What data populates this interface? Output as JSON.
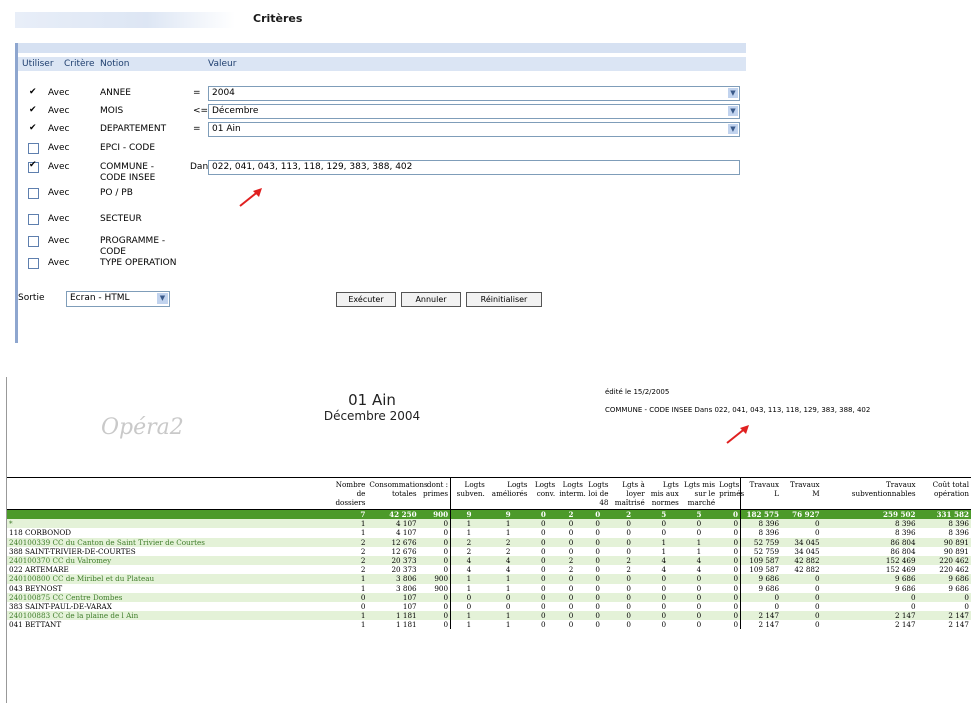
{
  "page_title": "Critères",
  "criteria": {
    "headers": {
      "utiliser": "Utiliser",
      "critere": "Critère",
      "notion": "Notion",
      "valeur": "Valeur"
    },
    "rows": [
      {
        "checked": true,
        "plain": true,
        "avec": "Avec",
        "notion": "ANNEE",
        "op": "=",
        "value": "2004",
        "dropdown": true
      },
      {
        "checked": true,
        "plain": true,
        "avec": "Avec",
        "notion": "MOIS",
        "op": "<=",
        "value": "Décembre",
        "dropdown": true
      },
      {
        "checked": true,
        "plain": true,
        "avec": "Avec",
        "notion": "DEPARTEMENT",
        "op": "=",
        "value": "01 Ain",
        "dropdown": true
      },
      {
        "checked": false,
        "avec": "Avec",
        "notion": "EPCI - CODE",
        "op": "",
        "value": null
      },
      {
        "checked": true,
        "avec": "Avec",
        "notion": "COMMUNE - CODE INSEE",
        "op": "Dans",
        "value": "022, 041, 043, 113, 118, 129, 383, 388, 402",
        "dropdown": false
      },
      {
        "checked": false,
        "avec": "Avec",
        "notion": "PO / PB",
        "op": "",
        "value": null
      },
      {
        "checked": false,
        "avec": "Avec",
        "notion": "SECTEUR",
        "op": "",
        "value": null
      },
      {
        "checked": false,
        "avec": "Avec",
        "notion": "PROGRAMME - CODE",
        "op": "",
        "value": null
      },
      {
        "checked": false,
        "avec": "Avec",
        "notion": "TYPE OPERATION",
        "op": "",
        "value": null
      }
    ],
    "sortie_label": "Sortie",
    "sortie_value": "Ecran - HTML",
    "buttons": {
      "executer": "Exécuter",
      "annuler": "Annuler",
      "reinitialiser": "Réinitialiser"
    }
  },
  "report": {
    "logo_text": "Opéra2",
    "title": "01 Ain",
    "subtitle": "Décembre 2004",
    "edite": "édité le 15/2/2005",
    "filter": "COMMUNE - CODE INSEE Dans 022, 041, 043, 113, 118, 129, 383, 388, 402",
    "columns": [
      "Nombre de dossiers",
      "Consommations totales",
      "dont : primes",
      "Logts subven.",
      "Logts améliorés",
      "Logts conv.",
      "Logts interm.",
      "Logts loi de 48",
      "Lgts à loyer maîtrisé",
      "Lgts mis aux normes",
      "Lgts mis sur le marché",
      "Logts primés",
      "Travaux L",
      "Travaux M",
      "Travaux subventionnables",
      "Coût total opération"
    ],
    "total": [
      "7",
      "42 250",
      "900",
      "9",
      "9",
      "0",
      "2",
      "0",
      "2",
      "5",
      "5",
      "0",
      "182 575",
      "76 927",
      "259 502",
      "331 582"
    ],
    "rows": [
      {
        "type": "lg",
        "label": "*",
        "values": [
          "1",
          "4 107",
          "0",
          "1",
          "1",
          "0",
          "0",
          "0",
          "0",
          "0",
          "0",
          "0",
          "8 396",
          "0",
          "8 396",
          "8 396"
        ]
      },
      {
        "type": "c",
        "label": "118 CORBONOD",
        "values": [
          "1",
          "4 107",
          "0",
          "1",
          "1",
          "0",
          "0",
          "0",
          "0",
          "0",
          "0",
          "0",
          "8 396",
          "0",
          "8 396",
          "8 396"
        ]
      },
      {
        "type": "lg",
        "label": "240100339 CC du Canton de Saint Trivier de Courtes",
        "values": [
          "2",
          "12 676",
          "0",
          "2",
          "2",
          "0",
          "0",
          "0",
          "0",
          "1",
          "1",
          "0",
          "52 759",
          "34 045",
          "86 804",
          "90 891"
        ]
      },
      {
        "type": "c",
        "label": "388 SAINT-TRIVIER-DE-COURTES",
        "values": [
          "2",
          "12 676",
          "0",
          "2",
          "2",
          "0",
          "0",
          "0",
          "0",
          "1",
          "1",
          "0",
          "52 759",
          "34 045",
          "86 804",
          "90 891"
        ]
      },
      {
        "type": "lg",
        "label": "240100370 CC du Valromey",
        "values": [
          "2",
          "20 373",
          "0",
          "4",
          "4",
          "0",
          "2",
          "0",
          "2",
          "4",
          "4",
          "0",
          "109 587",
          "42 882",
          "152 469",
          "220 462"
        ]
      },
      {
        "type": "c",
        "label": "022 ARTEMARE",
        "values": [
          "2",
          "20 373",
          "0",
          "4",
          "4",
          "0",
          "2",
          "0",
          "2",
          "4",
          "4",
          "0",
          "109 587",
          "42 882",
          "152 469",
          "220 462"
        ]
      },
      {
        "type": "lg",
        "label": "240100800 CC de Miribel et du Plateau",
        "values": [
          "1",
          "3 806",
          "900",
          "1",
          "1",
          "0",
          "0",
          "0",
          "0",
          "0",
          "0",
          "0",
          "9 686",
          "0",
          "9 686",
          "9 686"
        ]
      },
      {
        "type": "c",
        "label": "043 BEYNOST",
        "values": [
          "1",
          "3 806",
          "900",
          "1",
          "1",
          "0",
          "0",
          "0",
          "0",
          "0",
          "0",
          "0",
          "9 686",
          "0",
          "9 686",
          "9 686"
        ]
      },
      {
        "type": "lg",
        "label": "240100875 CC Centre Dombes",
        "values": [
          "0",
          "107",
          "0",
          "0",
          "0",
          "0",
          "0",
          "0",
          "0",
          "0",
          "0",
          "0",
          "0",
          "0",
          "0",
          "0"
        ]
      },
      {
        "type": "c",
        "label": "383 SAINT-PAUL-DE-VARAX",
        "values": [
          "0",
          "107",
          "0",
          "0",
          "0",
          "0",
          "0",
          "0",
          "0",
          "0",
          "0",
          "0",
          "0",
          "0",
          "0",
          "0"
        ]
      },
      {
        "type": "lg",
        "label": "240100883 CC de la plaine de l Ain",
        "values": [
          "1",
          "1 181",
          "0",
          "1",
          "1",
          "0",
          "0",
          "0",
          "0",
          "0",
          "0",
          "0",
          "2 147",
          "0",
          "2 147",
          "2 147"
        ]
      },
      {
        "type": "c",
        "label": "041 BETTANT",
        "values": [
          "1",
          "1 181",
          "0",
          "1",
          "1",
          "0",
          "0",
          "0",
          "0",
          "0",
          "0",
          "0",
          "2 147",
          "0",
          "2 147",
          "2 147"
        ]
      }
    ]
  },
  "colors": {
    "header_blue": "#dbe5f4",
    "total_green": "#4c9a2a",
    "row_light_green": "#e4f2d8",
    "arrow_red": "#e02020"
  }
}
